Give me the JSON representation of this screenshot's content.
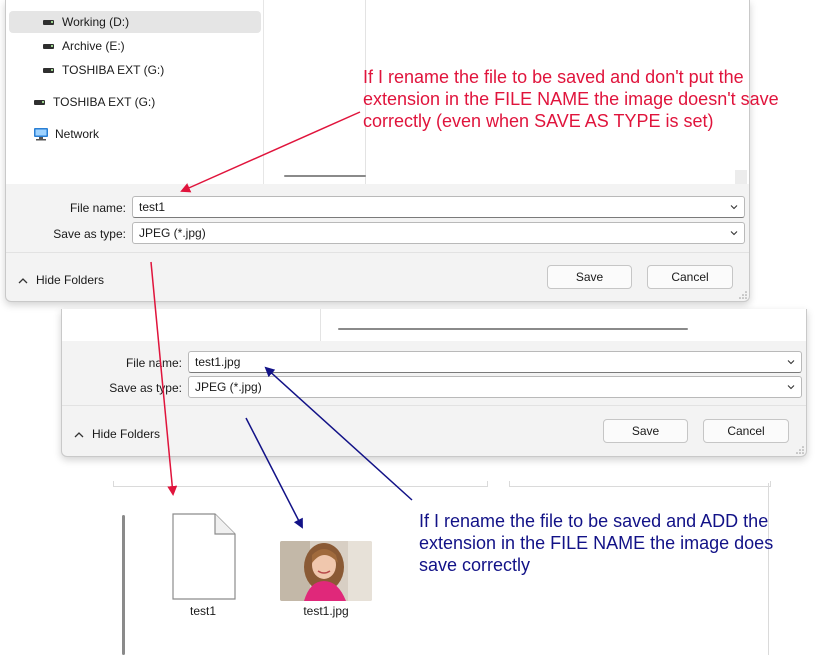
{
  "dialog_top": {
    "nav_items": [
      {
        "label": "Working (D:)",
        "icon": "drive-icon",
        "selected": true
      },
      {
        "label": "Archive (E:)",
        "icon": "drive-icon",
        "selected": false
      },
      {
        "label": "TOSHIBA EXT (G:)",
        "icon": "drive-icon",
        "selected": false
      },
      {
        "label": "TOSHIBA EXT (G:)",
        "icon": "drive-icon",
        "selected": false
      },
      {
        "label": "Network",
        "icon": "network-icon",
        "selected": false
      }
    ],
    "file_name_label": "File name:",
    "file_name_value": "test1",
    "save_type_label": "Save as type:",
    "save_type_value": "JPEG (*.jpg)",
    "hide_folders_label": "Hide Folders",
    "save_button": "Save",
    "cancel_button": "Cancel"
  },
  "dialog_bottom": {
    "file_name_label": "File name:",
    "file_name_value": "test1.jpg",
    "save_type_label": "Save as type:",
    "save_type_value": "JPEG (*.jpg)",
    "hide_folders_label": "Hide Folders",
    "save_button": "Save",
    "cancel_button": "Cancel"
  },
  "explorer": {
    "files": [
      {
        "name": "test1",
        "icon": "blank-file-icon"
      },
      {
        "name": "test1.jpg",
        "icon": "image-thumbnail"
      }
    ]
  },
  "annotations": {
    "top": "If I rename the file to be saved and don't put the extension in the FILE NAME the image doesn't save correctly (even when SAVE AS TYPE is set)",
    "bottom": "If I rename the file to be saved and ADD the extension in the FILE NAME the image does save correctly"
  },
  "colors": {
    "annotation_red": "#e0143c",
    "annotation_blue": "#121287",
    "dialog_background": "#f3f3f3",
    "selected_nav": "#e5e5e5"
  }
}
